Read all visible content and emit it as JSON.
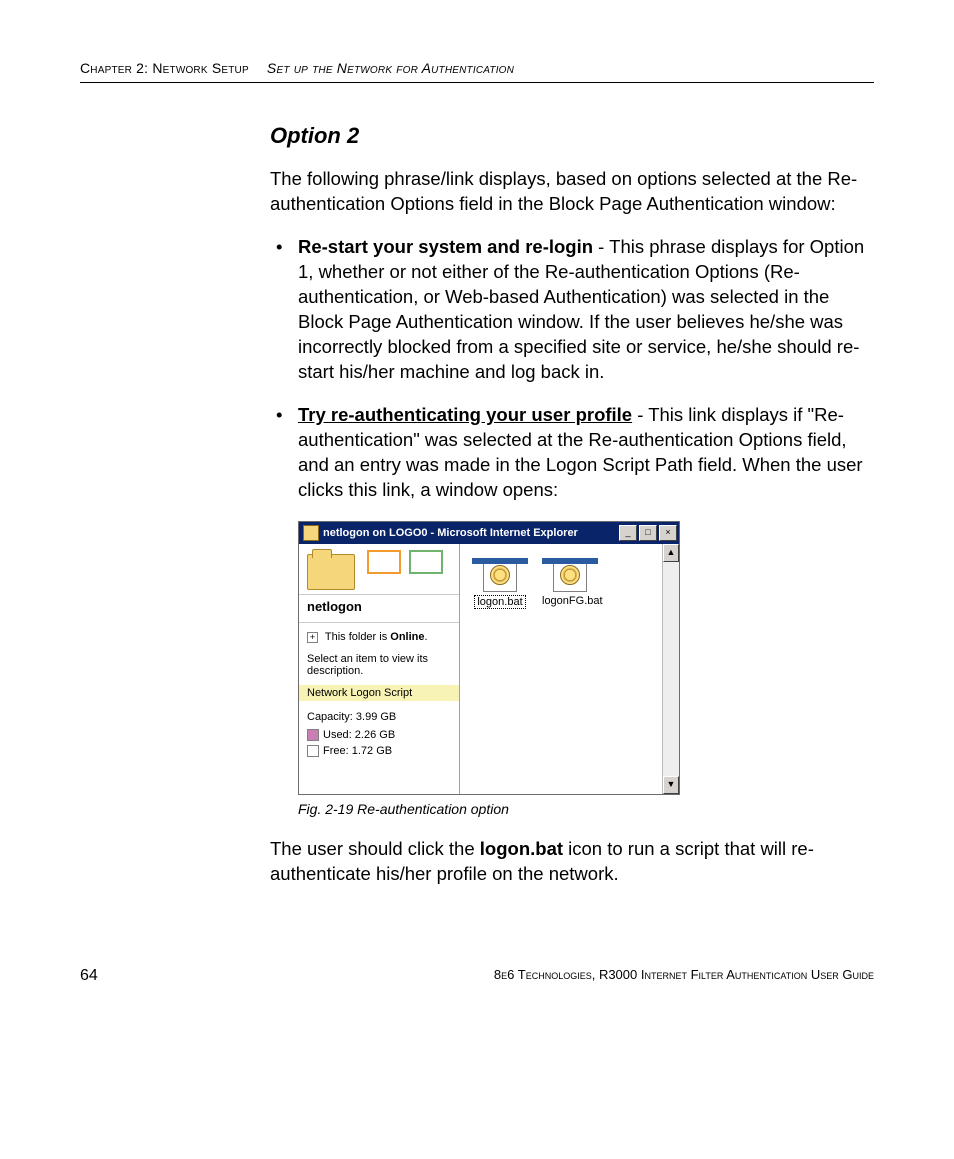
{
  "header": {
    "chapter": "Chapter 2: Network Setup",
    "section": "Set up the Network for Authentication"
  },
  "heading": "Option 2",
  "intro": "The following phrase/link displays, based on options selected at the Re-authentication Options field in the Block Page Authentication window:",
  "bullet1": {
    "lead": "Re-start your system and re-login",
    "rest": " - This phrase displays for Option 1, whether or not either of the Re-authentication Options (Re-authentication, or Web-based Authentication) was selected in the Block Page Authentication window. If the user believes he/she was incorrectly blocked from a specified site or service, he/she should re-start his/her machine and log back in."
  },
  "bullet2": {
    "lead": "Try re-authenticating your user profile",
    "rest": " - This link displays if \"Re-authentication\" was selected at the Re-authentication Options field, and an entry was made in the Logon Script Path field. When the user clicks this link, a window opens:"
  },
  "window": {
    "title": "netlogon on LOGO0 - Microsoft Internet Explorer",
    "btn_min": "_",
    "btn_max": "□",
    "btn_close": "×",
    "folder_name": "netlogon",
    "online_prefix": "This folder is ",
    "online_word": "Online",
    "online_suffix": ".",
    "select_text": "Select an item to view its description.",
    "link": "Network Logon Script",
    "capacity": "Capacity: 3.99 GB",
    "used": "Used: 2.26 GB",
    "free": "Free: 1.72 GB",
    "file1": "logon.bat",
    "file2": "logonFG.bat",
    "scroll_up": "▲",
    "scroll_down": "▼"
  },
  "caption": "Fig. 2-19  Re-authentication option",
  "closing": {
    "pre": "The user should click the ",
    "bold": "logon.bat",
    "post": " icon to run a script that will re-authenticate his/her profile on the network."
  },
  "footer": {
    "page": "64",
    "right": "8e6 Technologies, R3000 Internet Filter Authentication User Guide"
  }
}
